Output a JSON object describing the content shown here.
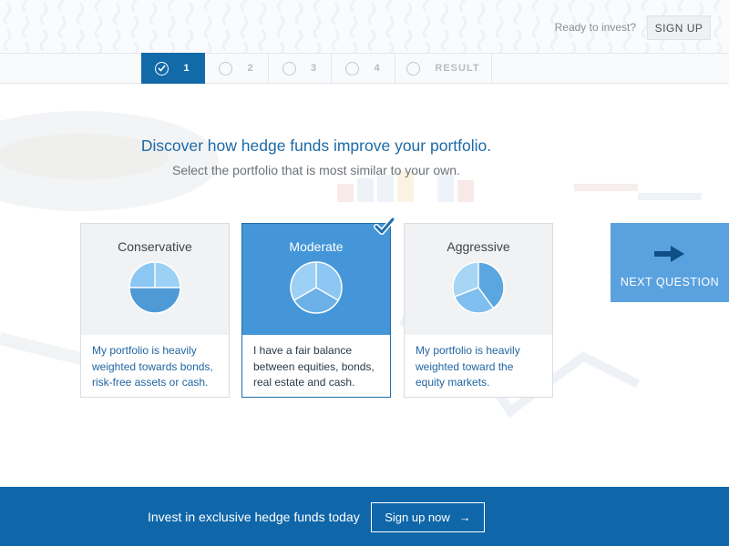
{
  "header": {
    "ready_text": "Ready to invest?",
    "signup_label": "SIGN UP"
  },
  "steps": [
    {
      "label": "1",
      "state": "done"
    },
    {
      "label": "2",
      "state": "pending"
    },
    {
      "label": "3",
      "state": "pending"
    },
    {
      "label": "4",
      "state": "pending"
    },
    {
      "label": "RESULT",
      "state": "pending"
    }
  ],
  "main": {
    "headline": "Discover how hedge funds improve your portfolio.",
    "subline": "Select the portfolio that is most similar to your own."
  },
  "cards": [
    {
      "title": "Conservative",
      "description": "My portfolio is heavily weighted towards bonds, risk-free assets or cash.",
      "selected": false
    },
    {
      "title": "Moderate",
      "description": "I have a fair balance between equities, bonds, real estate and cash.",
      "selected": true
    },
    {
      "title": "Aggressive",
      "description": "My portfolio is heavily weighted toward the equity markets.",
      "selected": false
    }
  ],
  "next": {
    "label": "NEXT QUESTION",
    "icon": "arrow-right-icon"
  },
  "footer": {
    "text": "Invest in exclusive hedge funds today",
    "button_label": "Sign up now",
    "button_arrow": "→"
  },
  "colors": {
    "brand_blue": "#0f66a9",
    "selected_blue": "#4596d8",
    "next_blue": "#5aa2df",
    "text_blue": "#2166a2"
  }
}
